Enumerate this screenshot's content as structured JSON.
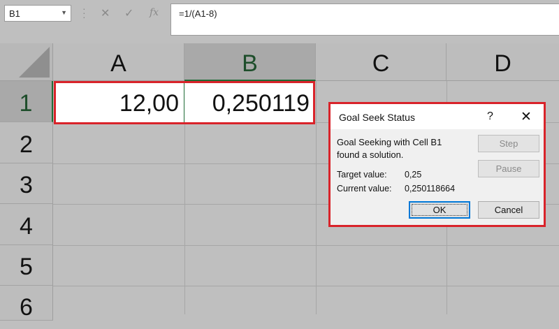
{
  "formula_bar": {
    "name_box": "B1",
    "cancel_icon": "✕",
    "enter_icon": "✓",
    "fx_icon": "fx",
    "formula": "=1/(A1-8)"
  },
  "columns": [
    "A",
    "B",
    "C",
    "D"
  ],
  "rows": [
    "1",
    "2",
    "3",
    "4",
    "5",
    "6"
  ],
  "cells": {
    "A1": "12,00",
    "B1": "0,250119"
  },
  "dialog": {
    "title": "Goal Seek Status",
    "help": "?",
    "close": "✕",
    "message_line1": "Goal Seeking with Cell B1",
    "message_line2": "found a solution.",
    "target_label": "Target value:",
    "target_value": "0,25",
    "current_label": "Current value:",
    "current_value": "0,250118664",
    "step_button": "Step",
    "pause_button": "Pause",
    "ok_button": "OK",
    "cancel_button": "Cancel"
  },
  "colors": {
    "highlight": "#d9232a",
    "selection_green": "#1e6b35",
    "focus_blue": "#0078d7"
  }
}
